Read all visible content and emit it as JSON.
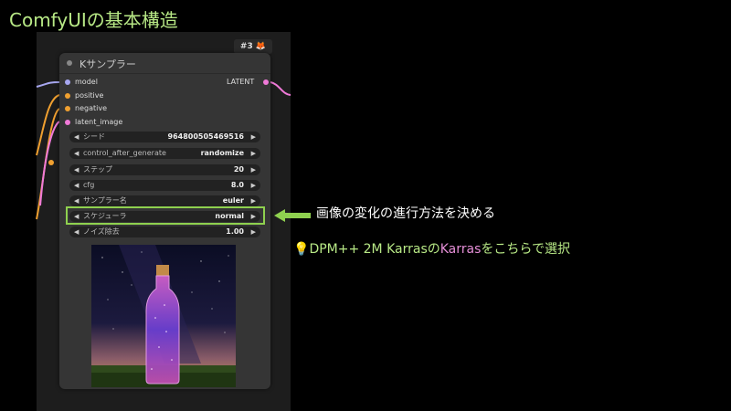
{
  "slide": {
    "title": "ComfyUIの基本構造"
  },
  "node": {
    "badge": "#3 🦊",
    "title": "Kサンプラー",
    "inputs": [
      {
        "label": "model",
        "color": "#a7a7f0"
      },
      {
        "label": "positive",
        "color": "#f0a030"
      },
      {
        "label": "negative",
        "color": "#f0a030"
      },
      {
        "label": "latent_image",
        "color": "#f07ad8"
      }
    ],
    "output": {
      "label": "LATENT",
      "color": "#f07ad8"
    },
    "widgets": [
      {
        "label": "シード",
        "value": "964800505469516"
      },
      {
        "label": "control_after_generate",
        "value": "randomize"
      },
      {
        "label": "ステップ",
        "value": "20"
      },
      {
        "label": "cfg",
        "value": "8.0"
      },
      {
        "label": "サンプラー名",
        "value": "euler"
      },
      {
        "label": "スケジューラ",
        "value": "normal"
      },
      {
        "label": "ノイズ除去",
        "value": "1.00"
      }
    ]
  },
  "icons": {
    "left_arrow": "◀",
    "right_arrow": "▶",
    "bulb": "💡"
  },
  "callout": {
    "text": "画像の変化の進行方法を決める"
  },
  "tip": {
    "part1": "DPM++ 2M Karrasの",
    "highlight": "Karras",
    "part2": "をこちらで選択"
  },
  "colors": {
    "accent_green": "#8fd14f",
    "title_green": "#b8e986",
    "pink": "#e68fd8"
  }
}
